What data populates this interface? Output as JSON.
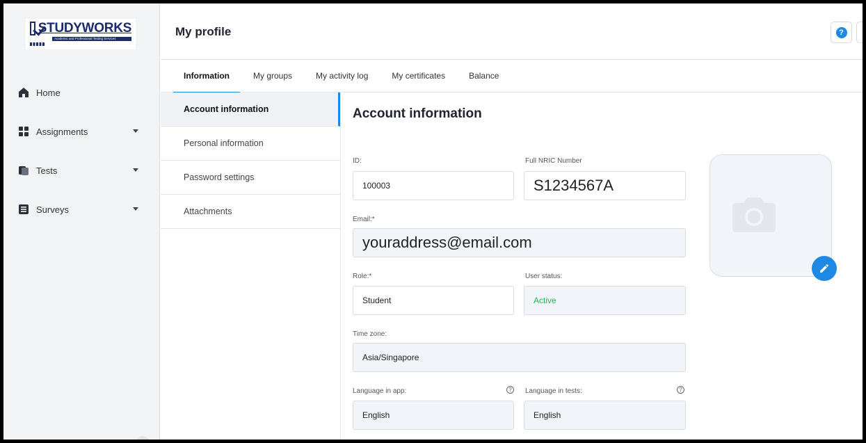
{
  "brand": {
    "name": "STUDYWORKS",
    "tagline": "Academic and Professional Testing Services"
  },
  "sidebar": {
    "items": [
      {
        "label": "Home",
        "icon": "home-icon"
      },
      {
        "label": "Assignments",
        "icon": "assignments-icon"
      },
      {
        "label": "Tests",
        "icon": "tests-icon"
      },
      {
        "label": "Surveys",
        "icon": "surveys-icon"
      }
    ]
  },
  "header": {
    "title": "My profile",
    "help_label": "?"
  },
  "tabs": [
    {
      "label": "Information",
      "active": true
    },
    {
      "label": "My groups"
    },
    {
      "label": "My activity log"
    },
    {
      "label": "My certificates"
    },
    {
      "label": "Balance"
    }
  ],
  "submenu": [
    {
      "label": "Account information",
      "active": true
    },
    {
      "label": "Personal information"
    },
    {
      "label": "Password settings"
    },
    {
      "label": "Attachments"
    }
  ],
  "form": {
    "title": "Account information",
    "id_label": "ID:",
    "id_value": "100003",
    "nric_label": "Full NRIC Number",
    "nric_value": "S1234567A",
    "email_label": "Email:*",
    "email_value": "youraddress@email.com",
    "role_label": "Role:*",
    "role_value": "Student",
    "status_label": "User status:",
    "status_value": "Active",
    "timezone_label": "Time zone:",
    "timezone_value": "Asia/Singapore",
    "lang_app_label": "Language in app:",
    "lang_app_value": "English",
    "lang_tests_label": "Language in tests:",
    "lang_tests_value": "English"
  },
  "colors": {
    "accent": "#1e88e5",
    "status_active": "#2bb35a",
    "brand": "#1b2a6b"
  }
}
